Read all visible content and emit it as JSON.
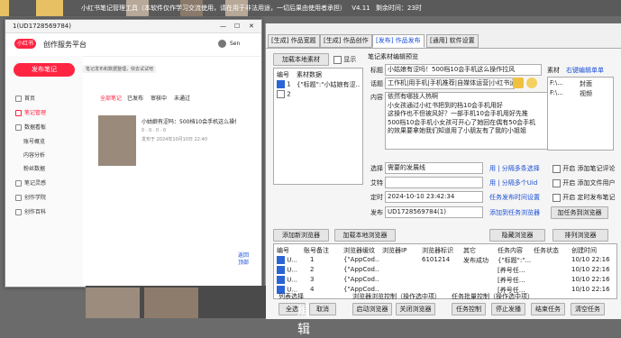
{
  "topbar": {
    "prefix": "…",
    "text": "小红书笔记管理工具（本软件仅作学习交流使用，请在用于非法用途，一切后果由使用者承担）",
    "version": "V4.11",
    "remaining": "剩余时间：23时"
  },
  "browser": {
    "title": "1(UD1728569784)",
    "app_name": "创作服务平台",
    "logo": "小红书",
    "username": "Sen",
    "publish_button": "发布笔记",
    "tooltip": "笔记发布和数据整理，快去试试吧",
    "sidebar": [
      "首页",
      "笔记管理",
      "数据看板",
      "账号概览",
      "内容分析",
      "粉丝数据",
      "笔记灵感",
      "创作学院",
      "创作百科"
    ],
    "active_sidebar_index": 1,
    "content_tabs": [
      "全部笔记",
      "已发布",
      "审核中",
      "未通过"
    ],
    "note_title": "小姑娘有涩吗：500档10会手机这么操作拉风",
    "note_stats": "0 · 0 · 0 · 0",
    "note_date": "发布于 2024年10月10日 22:40",
    "back_to_top": "返回顶部"
  },
  "tool": {
    "tabs": [
      "[生成] 作品宽题",
      "[生成] 作品创作",
      "[发布] 作品发布",
      "[通用] 软件设置"
    ],
    "active_tab": 2,
    "add_local_material": "加载本地素材",
    "show_label": "显示",
    "material_table": {
      "headers": [
        "编号",
        "素材数据"
      ],
      "rows": [
        {
          "id": "1",
          "data": "{\"标题\":\"小姑娘有涩…",
          "checked": true
        },
        {
          "id": "2",
          "data": "",
          "checked": false
        }
      ]
    },
    "preview_title": "笔记素材编辑预览",
    "fields": {
      "title_label": "标题",
      "title_value": "小姑娘有涩吗！500档10会手机这么操作拉风",
      "topic_label": "话题",
      "topic_value": "工作机|用手机|手机推荐|自媒体运营|小红书运营",
      "content_label": "内容",
      "content_lines": [
        "依然有哪技人热啊",
        "小女孩通过小红书把到的档10会手机用好",
        "这操作也不但被风好？一部手机10会手机用好先推",
        "500档10会手机小女孩可开心了她回在偶有50会手机",
        "的效果要拿她我们知道用了小朋友有了我的小姐姐"
      ],
      "location_label": "选择",
      "location_value": "需要的发展线",
      "location_hint": "用 | 分隔多条选择",
      "support_label": "艾特",
      "support_hint": "用 | 分隔多个Uid",
      "time_label": "定时",
      "time_value": "2024-10-10 23:42:34",
      "time_hint": "任务发布时间设置",
      "publish_label": "发布",
      "publish_value": "UD1728569784(1)",
      "publish_hint": "添加到任务浏览器",
      "add_task_button": "加任务到浏览器"
    },
    "material_panel": {
      "title": "素材",
      "hint": "右键编辑单单",
      "rows": [
        {
          "a": "F:\\...",
          "b": "封面"
        },
        {
          "a": "F:\\...",
          "b": "视频"
        }
      ]
    },
    "options": [
      "开启 添加笔记评论",
      "开启 添加文件用户",
      "开启 定时发布笔记"
    ],
    "browser_buttons": {
      "add": "添加新浏览器",
      "add_local": "加载本地浏览器",
      "hide": "隐藏浏览器",
      "arrange": "排列浏览器"
    },
    "task_table": {
      "headers": [
        "编号",
        "账号备注",
        "浏览器缓纹",
        "浏览器IP",
        "浏览器标识",
        "其它",
        "任务内容",
        "任务状态",
        "创建时间"
      ],
      "rows": [
        {
          "id": "U...",
          "note": "1",
          "cache": "{\"AppCod...",
          "ip": "",
          "mark": "6101214",
          "other": "发布成功",
          "content": "{\"标题\":\"...",
          "status": "",
          "time": "10/10 22:16"
        },
        {
          "id": "U...",
          "note": "2",
          "cache": "{\"AppCod...",
          "ip": "",
          "mark": "",
          "other": "",
          "content": "[养号任…",
          "status": "",
          "time": "10/10 22:16"
        },
        {
          "id": "U...",
          "note": "3",
          "cache": "{\"AppCod...",
          "ip": "",
          "mark": "",
          "other": "",
          "content": "[养号任…",
          "status": "",
          "time": "10/10 22:16"
        },
        {
          "id": "U...",
          "note": "4",
          "cache": "{\"AppCod...",
          "ip": "",
          "mark": "",
          "other": "",
          "content": "[养号任…",
          "status": "",
          "time": "10/10 22:16"
        }
      ]
    },
    "bottom": {
      "list_select": "列表选择",
      "browser_control": "浏览器浏览控制（操作选中项）",
      "task_control": "任务批量控制（操作选中项）",
      "buttons": [
        "全选",
        "取消",
        "启动浏览器",
        "关闭浏览器",
        "任务控制",
        "停止发播",
        "结束任务",
        "清空任务"
      ]
    }
  },
  "tray_text": "编辑"
}
